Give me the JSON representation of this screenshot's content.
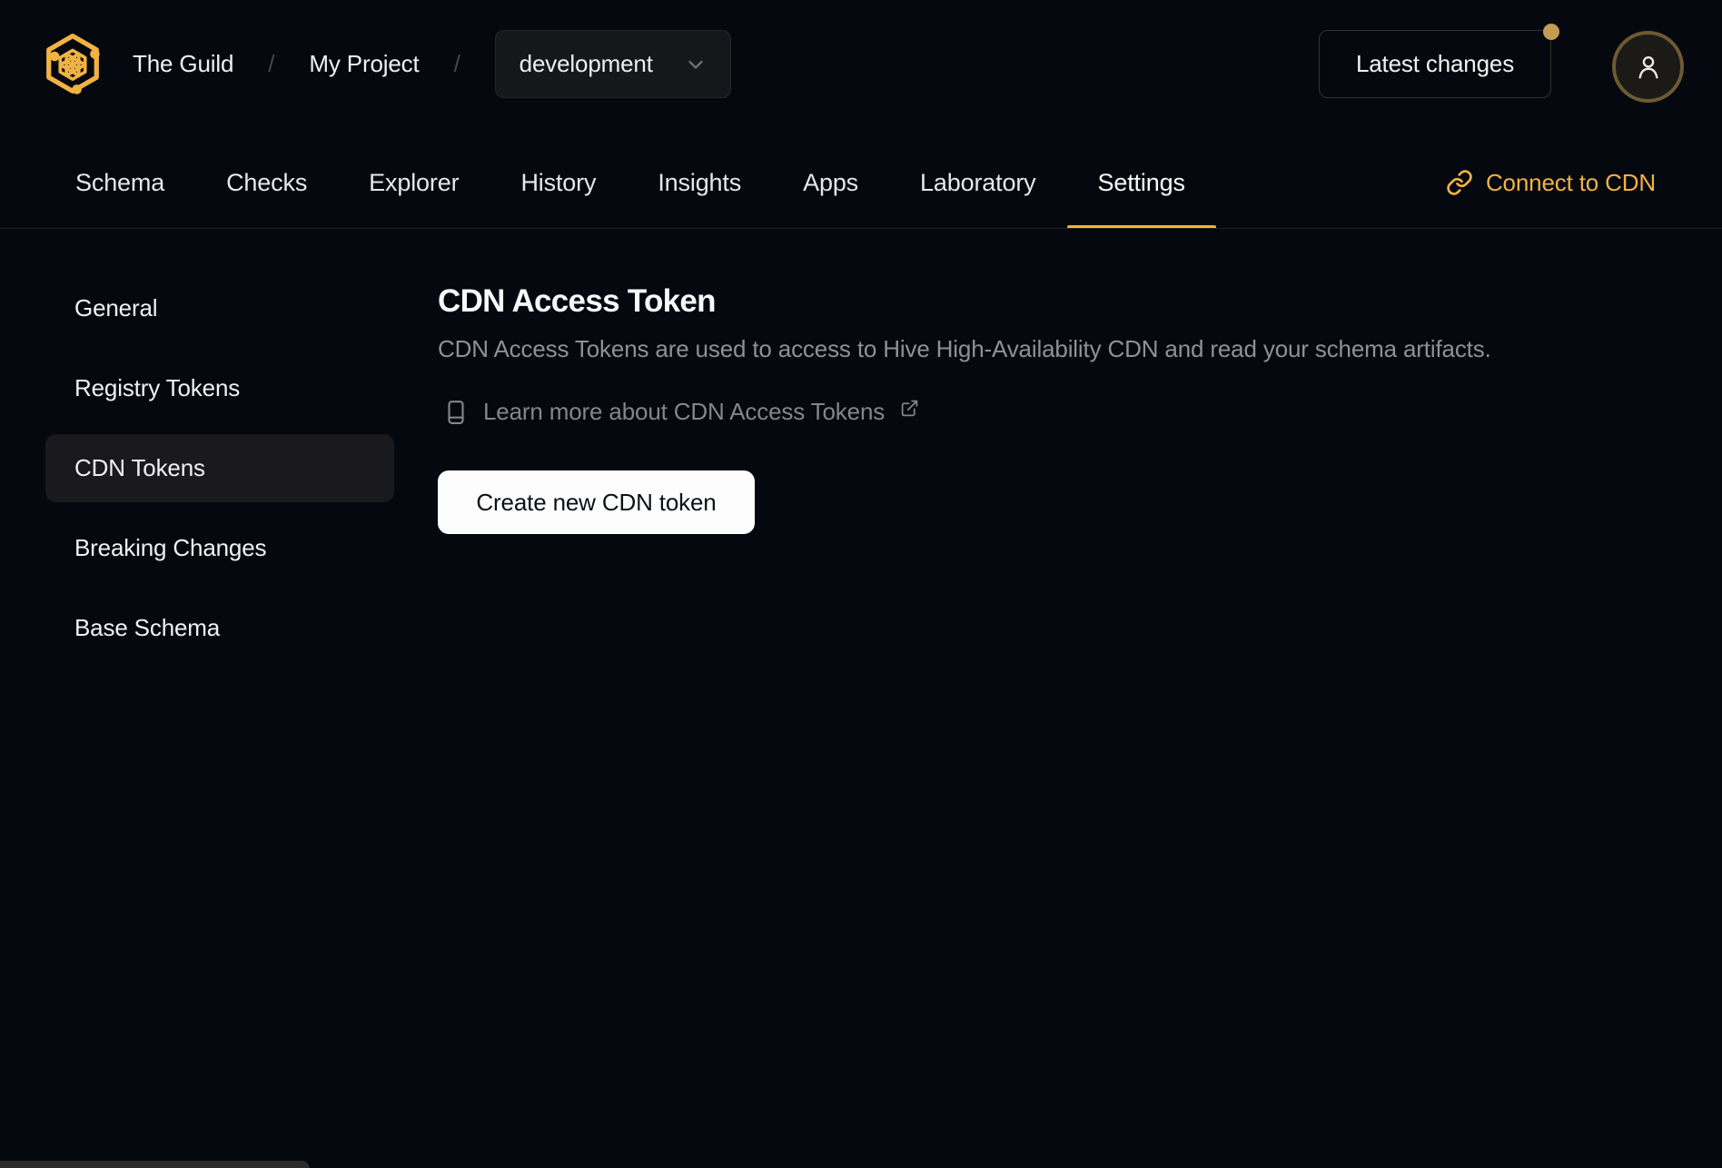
{
  "header": {
    "org": "The Guild",
    "project": "My Project",
    "separator": "/",
    "target_selector": {
      "value": "development",
      "chevron_icon": "chevron-down-icon"
    },
    "latest_changes_label": "Latest changes",
    "logo_icon": "guild-honeycomb-logo",
    "avatar_icon": "user-icon",
    "notification_dot_color": "#c49c52"
  },
  "tabs": {
    "items": [
      {
        "label": "Schema",
        "active": false
      },
      {
        "label": "Checks",
        "active": false
      },
      {
        "label": "Explorer",
        "active": false
      },
      {
        "label": "History",
        "active": false
      },
      {
        "label": "Insights",
        "active": false
      },
      {
        "label": "Apps",
        "active": false
      },
      {
        "label": "Laboratory",
        "active": false
      },
      {
        "label": "Settings",
        "active": true
      }
    ],
    "connect_cdn": {
      "label": "Connect to CDN",
      "icon": "link-icon"
    }
  },
  "sidebar": {
    "items": [
      {
        "label": "General",
        "active": false
      },
      {
        "label": "Registry Tokens",
        "active": false
      },
      {
        "label": "CDN Tokens",
        "active": true
      },
      {
        "label": "Breaking Changes",
        "active": false
      },
      {
        "label": "Base Schema",
        "active": false
      }
    ]
  },
  "main": {
    "title": "CDN Access Token",
    "description": "CDN Access Tokens are used to access to Hive High-Availability CDN and read your schema artifacts.",
    "learn_more": {
      "label": "Learn more about CDN Access Tokens",
      "book_icon": "book-icon",
      "external_icon": "external-link-icon"
    },
    "create_button": "Create new CDN token"
  },
  "colors": {
    "background": "#05080f",
    "accent_gold": "#f0b342",
    "dropdown_surface": "#16171a",
    "active_item_bg": "#1a1a1e",
    "muted_text": "#8f9197",
    "link_text": "#84868d",
    "button_bg": "#fdfdfe",
    "button_text": "#0d1016",
    "avatar_border": "#6e5a31",
    "notification_dot": "#c49c52",
    "bottom_toast": "#2b2b29"
  }
}
